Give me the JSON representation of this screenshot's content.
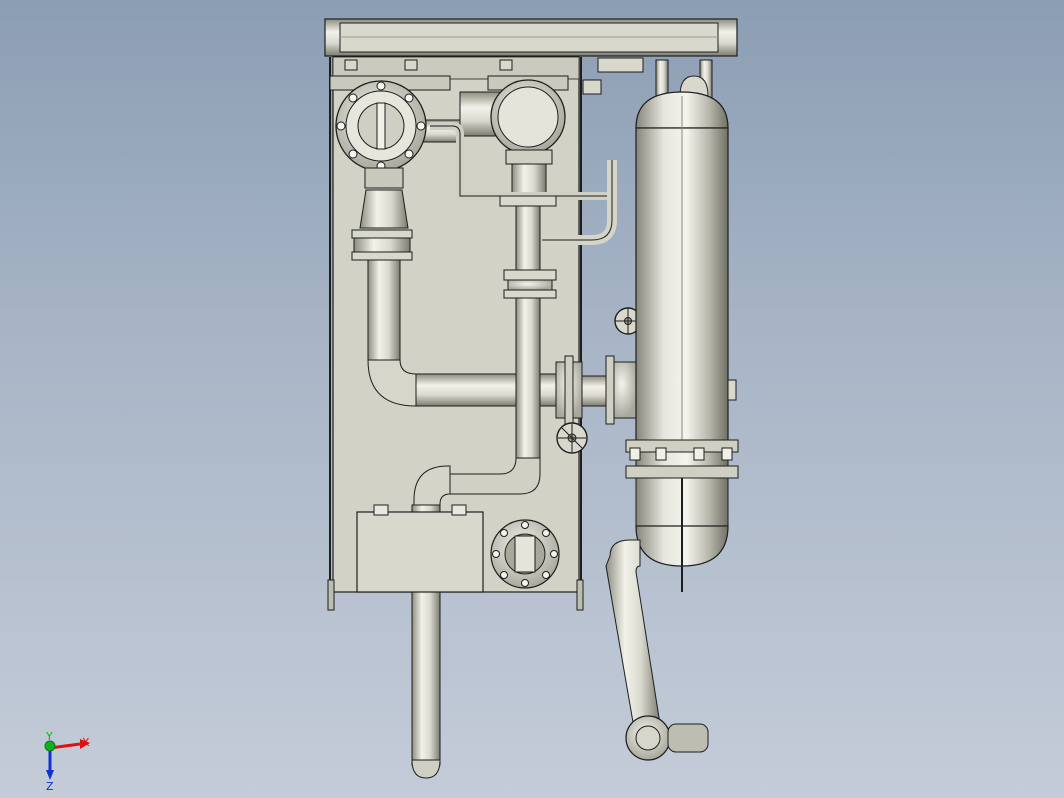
{
  "viewport": {
    "background_top": "#8c9eb4",
    "background_bottom": "#c4ccd8",
    "model_fill": "#d8d8cc",
    "model_edge": "#1e1e1e"
  },
  "triad": {
    "x_label": "X",
    "y_label": "Y",
    "z_label": "Z",
    "x_color": "#e01010",
    "y_color": "#10b020",
    "z_color": "#1030d0"
  }
}
